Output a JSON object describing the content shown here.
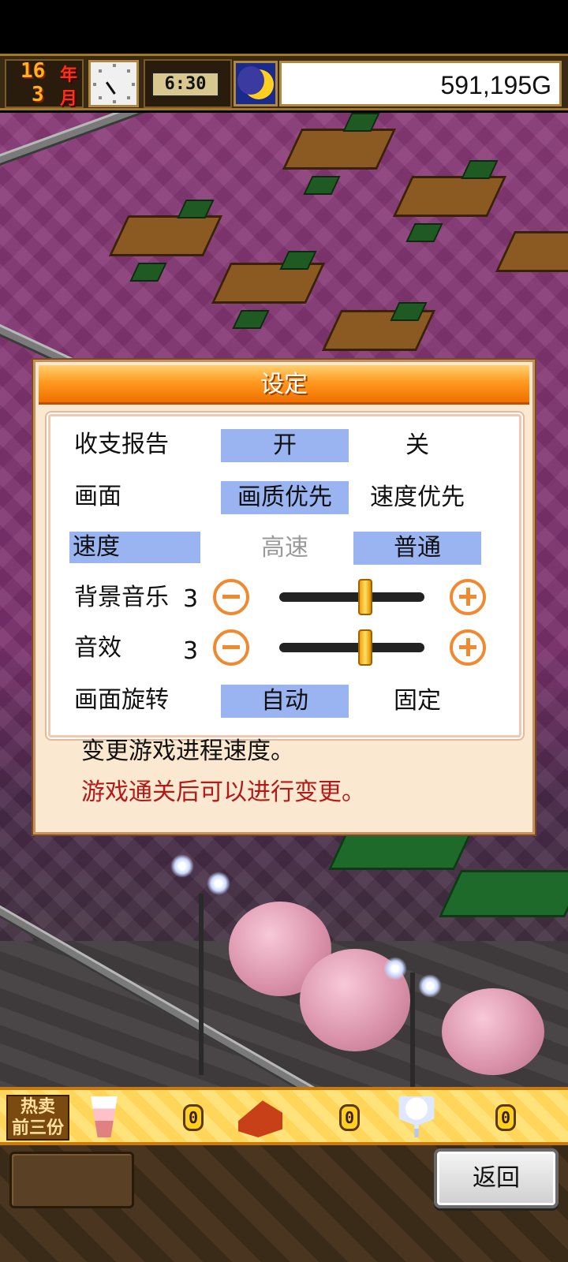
{
  "hud": {
    "year_number": "16",
    "year_unit": "年",
    "month_number": "3",
    "month_unit": "月",
    "time": "6:30",
    "money": "591,195G",
    "time_of_day_icon": "moon-icon",
    "clock_icon": "analog-clock-icon"
  },
  "dialog": {
    "title": "设定",
    "rows": {
      "report": {
        "label": "收支报告",
        "on": "开",
        "off": "关",
        "selected": "开"
      },
      "screen": {
        "label": "画面",
        "quality": "画质优先",
        "speed": "速度优先",
        "selected": "画质优先"
      },
      "speed": {
        "label": "速度",
        "fast": "高速",
        "normal": "普通",
        "selected": "普通"
      },
      "bgm": {
        "label": "背景音乐",
        "value": "3",
        "level": 0.6
      },
      "sfx": {
        "label": "音效",
        "value": "3",
        "level": 0.6
      },
      "rotation": {
        "label": "画面旋转",
        "auto": "自动",
        "fixed": "固定",
        "selected": "自动"
      }
    },
    "help_text": "变更游戏进程速度。",
    "warning_text": "游戏通关后可以进行变更。"
  },
  "bestsellers": {
    "label_line1": "热卖",
    "label_line2": "前三份",
    "items": [
      {
        "icon": "parfait-icon",
        "count": "0"
      },
      {
        "icon": "cake-icon",
        "count": "0"
      },
      {
        "icon": "sundae-icon",
        "count": "0"
      }
    ]
  },
  "controls": {
    "back_label": "返回"
  },
  "colors": {
    "selected_option_bg": "#9ab4f2",
    "header_orange": "#ff9a20",
    "warning_red": "#b41818",
    "adjust_orange": "#f08a30"
  }
}
